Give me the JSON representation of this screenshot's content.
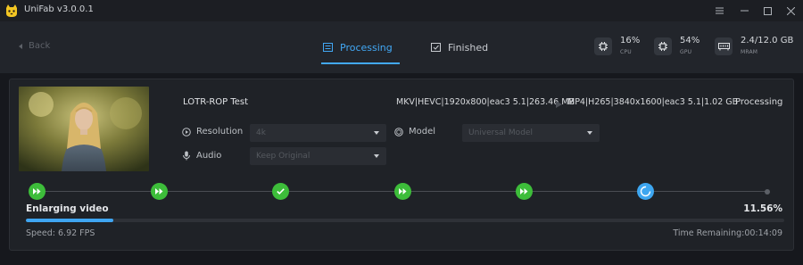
{
  "window": {
    "title": "UniFab v3.0.0.1",
    "controls": [
      "menu-icon",
      "minimize-icon",
      "maximize-icon",
      "close-icon"
    ]
  },
  "nav": {
    "back_label": "Back",
    "tabs": [
      {
        "label": "Processing",
        "icon": "processing-list-icon",
        "active": true
      },
      {
        "label": "Finished",
        "icon": "finished-check-icon",
        "active": false
      }
    ],
    "stats": [
      {
        "value": "16%",
        "label": "CPU",
        "icon": "cpu-chip-icon"
      },
      {
        "value": "54%",
        "label": "GPU",
        "icon": "gpu-chip-icon"
      },
      {
        "value": "2.4/12.0 GB",
        "label": "MRAM",
        "icon": "memory-icon"
      }
    ]
  },
  "task": {
    "name": "LOTR-ROP Test",
    "source_info": "MKV|HEVC|1920x800|eac3 5.1|263.46 MB",
    "target_info": "MP4|H265|3840x1600|eac3 5.1|1.02 GB",
    "status": "Processing",
    "options": {
      "resolution_label": "Resolution",
      "resolution_value": "4k",
      "model_label": "Model",
      "model_value": "Universal Model",
      "audio_label": "Audio",
      "audio_value": "Keep Original"
    },
    "steps": [
      "done-play",
      "done-play",
      "done-check",
      "done-play",
      "done-play",
      "in-progress",
      "pending"
    ],
    "phase": "Enlarging video",
    "percent_text": "11.56%",
    "progress_fraction": 0.1156,
    "speed": "Speed: 6.92  FPS",
    "time_remaining": "Time Remaining:00:14:09"
  },
  "colors": {
    "accent": "#42a8f5",
    "success": "#3dbd3a",
    "background": "#16181d"
  }
}
